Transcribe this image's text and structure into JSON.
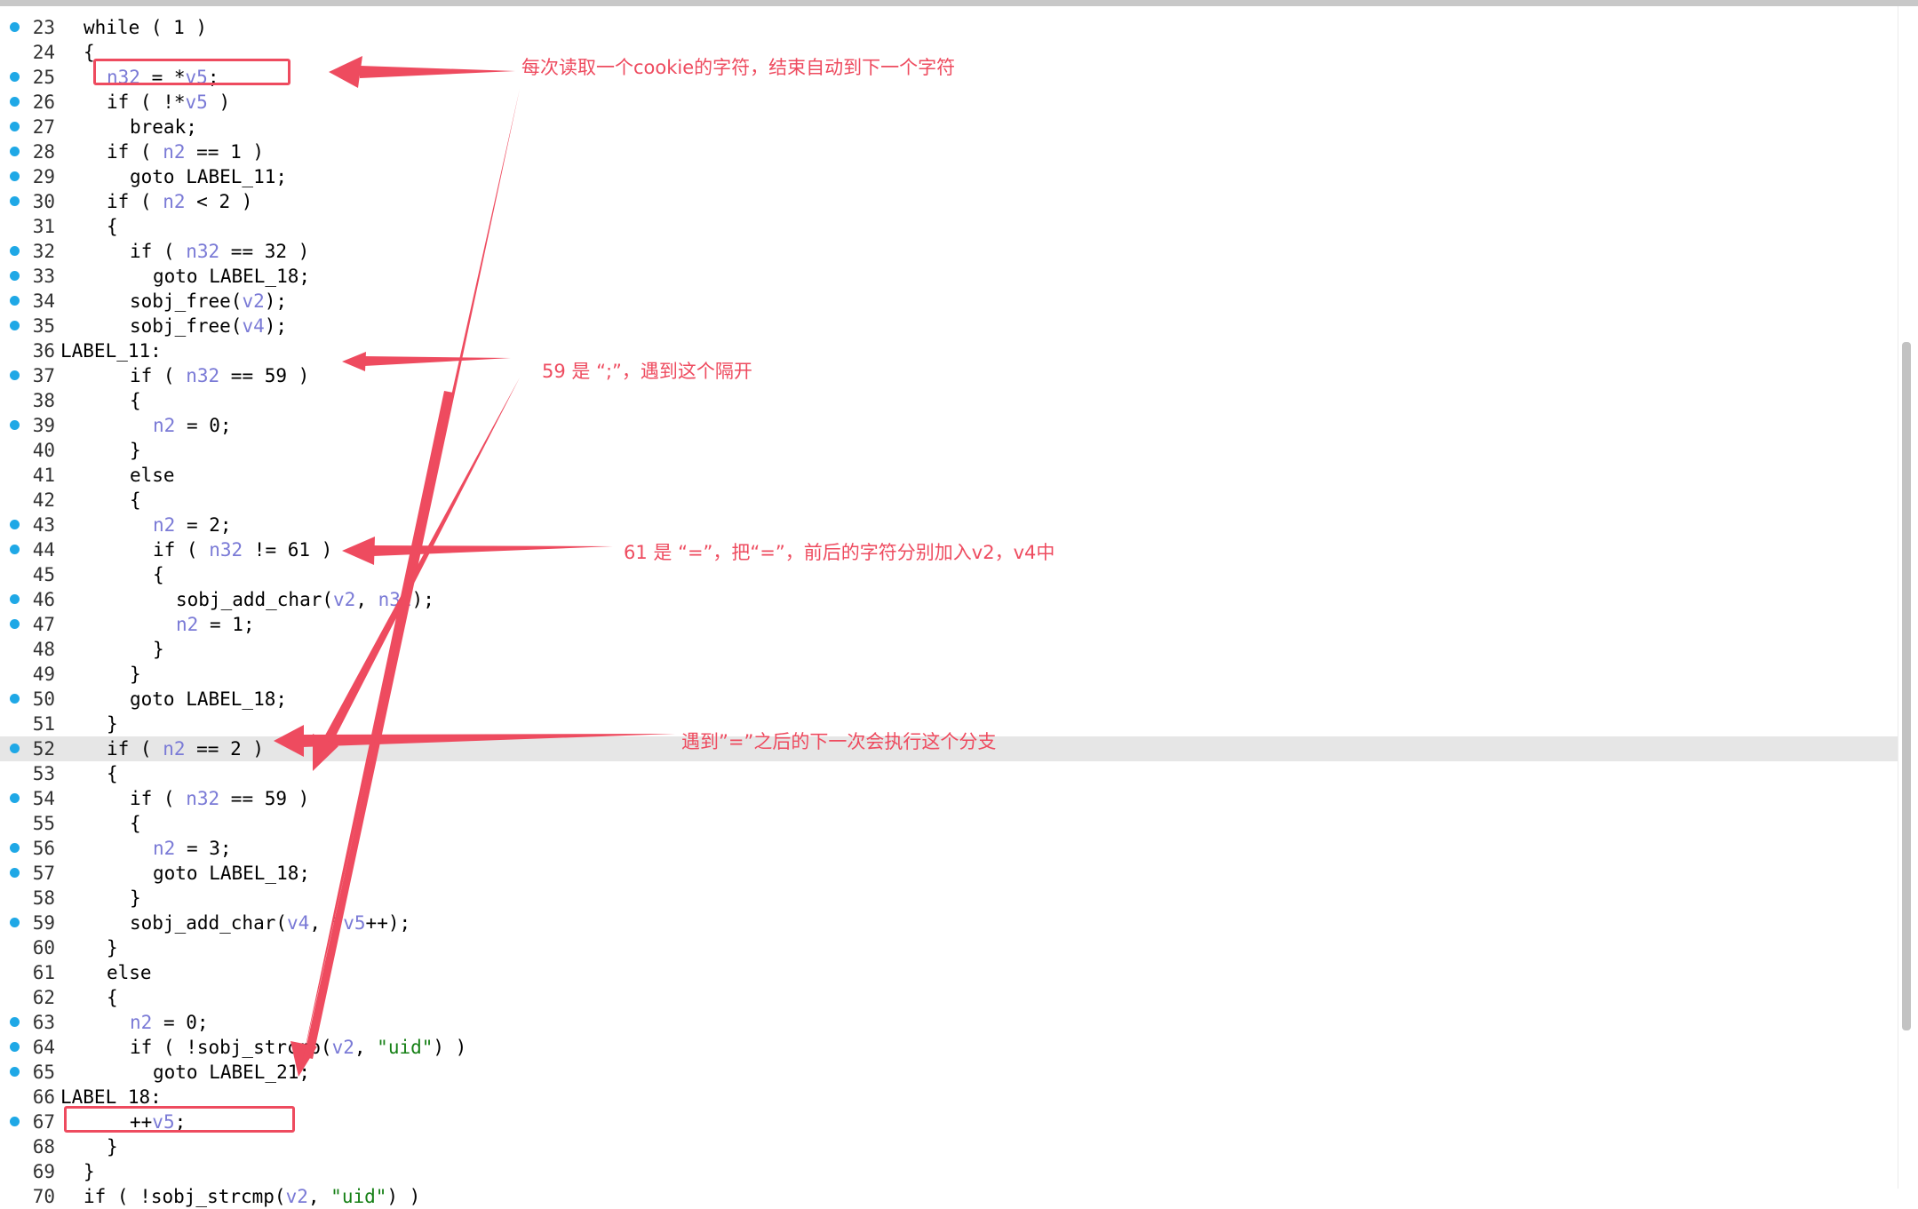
{
  "code_lines": [
    {
      "num": "23",
      "dot": true,
      "indent": 1,
      "tokens": [
        [
          "while ( 1 )",
          ""
        ]
      ]
    },
    {
      "num": "24",
      "dot": false,
      "indent": 1,
      "tokens": [
        [
          "{",
          ""
        ]
      ]
    },
    {
      "num": "25",
      "dot": true,
      "indent": 2,
      "tokens": [
        [
          "n32",
          "v"
        ],
        [
          " = *",
          ""
        ],
        [
          "v5",
          "v"
        ],
        [
          ";",
          ""
        ]
      ]
    },
    {
      "num": "26",
      "dot": true,
      "indent": 2,
      "tokens": [
        [
          "if ( !*",
          ""
        ],
        [
          "v5",
          "v"
        ],
        [
          " )",
          ""
        ]
      ]
    },
    {
      "num": "27",
      "dot": true,
      "indent": 3,
      "tokens": [
        [
          "break;",
          ""
        ]
      ]
    },
    {
      "num": "28",
      "dot": true,
      "indent": 2,
      "tokens": [
        [
          "if ( ",
          ""
        ],
        [
          "n2",
          "v"
        ],
        [
          " == 1 )",
          ""
        ]
      ]
    },
    {
      "num": "29",
      "dot": true,
      "indent": 3,
      "tokens": [
        [
          "goto LABEL_11;",
          ""
        ]
      ]
    },
    {
      "num": "30",
      "dot": true,
      "indent": 2,
      "tokens": [
        [
          "if ( ",
          ""
        ],
        [
          "n2",
          "v"
        ],
        [
          " < 2 )",
          ""
        ]
      ]
    },
    {
      "num": "31",
      "dot": false,
      "indent": 2,
      "tokens": [
        [
          "{",
          ""
        ]
      ]
    },
    {
      "num": "32",
      "dot": true,
      "indent": 3,
      "tokens": [
        [
          "if ( ",
          ""
        ],
        [
          "n32",
          "v"
        ],
        [
          " == 32 )",
          ""
        ]
      ]
    },
    {
      "num": "33",
      "dot": true,
      "indent": 4,
      "tokens": [
        [
          "goto LABEL_18;",
          ""
        ]
      ]
    },
    {
      "num": "34",
      "dot": true,
      "indent": 3,
      "tokens": [
        [
          "sobj_free(",
          ""
        ],
        [
          "v2",
          "v"
        ],
        [
          ");",
          ""
        ]
      ]
    },
    {
      "num": "35",
      "dot": true,
      "indent": 3,
      "tokens": [
        [
          "sobj_free(",
          ""
        ],
        [
          "v4",
          "v"
        ],
        [
          ");",
          ""
        ]
      ]
    },
    {
      "num": "36",
      "dot": false,
      "indent": 0,
      "tokens": [
        [
          "LABEL_11:",
          ""
        ]
      ]
    },
    {
      "num": "37",
      "dot": true,
      "indent": 3,
      "tokens": [
        [
          "if ( ",
          ""
        ],
        [
          "n32",
          "v"
        ],
        [
          " == 59 )",
          ""
        ]
      ]
    },
    {
      "num": "38",
      "dot": false,
      "indent": 3,
      "tokens": [
        [
          "{",
          ""
        ]
      ]
    },
    {
      "num": "39",
      "dot": true,
      "indent": 4,
      "tokens": [
        [
          "n2",
          "v"
        ],
        [
          " = 0;",
          ""
        ]
      ]
    },
    {
      "num": "40",
      "dot": false,
      "indent": 3,
      "tokens": [
        [
          "}",
          ""
        ]
      ]
    },
    {
      "num": "41",
      "dot": false,
      "indent": 3,
      "tokens": [
        [
          "else",
          ""
        ]
      ]
    },
    {
      "num": "42",
      "dot": false,
      "indent": 3,
      "tokens": [
        [
          "{",
          ""
        ]
      ]
    },
    {
      "num": "43",
      "dot": true,
      "indent": 4,
      "tokens": [
        [
          "n2",
          "v"
        ],
        [
          " = 2;",
          ""
        ]
      ]
    },
    {
      "num": "44",
      "dot": true,
      "indent": 4,
      "tokens": [
        [
          "if ( ",
          ""
        ],
        [
          "n32",
          "v"
        ],
        [
          " != 61 )",
          ""
        ]
      ]
    },
    {
      "num": "45",
      "dot": false,
      "indent": 4,
      "tokens": [
        [
          "{",
          ""
        ]
      ]
    },
    {
      "num": "46",
      "dot": true,
      "indent": 5,
      "tokens": [
        [
          "sobj_add_char(",
          ""
        ],
        [
          "v2",
          "v"
        ],
        [
          ", ",
          ""
        ],
        [
          "n32",
          "v"
        ],
        [
          ");",
          ""
        ]
      ]
    },
    {
      "num": "47",
      "dot": true,
      "indent": 5,
      "tokens": [
        [
          "n2",
          "v"
        ],
        [
          " = 1;",
          ""
        ]
      ]
    },
    {
      "num": "48",
      "dot": false,
      "indent": 4,
      "tokens": [
        [
          "}",
          ""
        ]
      ]
    },
    {
      "num": "49",
      "dot": false,
      "indent": 3,
      "tokens": [
        [
          "}",
          ""
        ]
      ]
    },
    {
      "num": "50",
      "dot": true,
      "indent": 3,
      "tokens": [
        [
          "goto LABEL_18;",
          ""
        ]
      ]
    },
    {
      "num": "51",
      "dot": false,
      "indent": 2,
      "tokens": [
        [
          "}",
          ""
        ]
      ]
    },
    {
      "num": "52",
      "dot": true,
      "indent": 2,
      "hl": true,
      "tokens": [
        [
          "if ( ",
          ""
        ],
        [
          "n2",
          "v"
        ],
        [
          " == 2 )",
          ""
        ]
      ]
    },
    {
      "num": "53",
      "dot": false,
      "indent": 2,
      "tokens": [
        [
          "{",
          ""
        ]
      ]
    },
    {
      "num": "54",
      "dot": true,
      "indent": 3,
      "tokens": [
        [
          "if ( ",
          ""
        ],
        [
          "n32",
          "v"
        ],
        [
          " == 59 )",
          ""
        ]
      ]
    },
    {
      "num": "55",
      "dot": false,
      "indent": 3,
      "tokens": [
        [
          "{",
          ""
        ]
      ]
    },
    {
      "num": "56",
      "dot": true,
      "indent": 4,
      "tokens": [
        [
          "n2",
          "v"
        ],
        [
          " = 3;",
          ""
        ]
      ]
    },
    {
      "num": "57",
      "dot": true,
      "indent": 4,
      "tokens": [
        [
          "goto LABEL_18;",
          ""
        ]
      ]
    },
    {
      "num": "58",
      "dot": false,
      "indent": 3,
      "tokens": [
        [
          "}",
          ""
        ]
      ]
    },
    {
      "num": "59",
      "dot": true,
      "indent": 3,
      "tokens": [
        [
          "sobj_add_char(",
          ""
        ],
        [
          "v4",
          "v"
        ],
        [
          ", *",
          ""
        ],
        [
          "v5",
          "v"
        ],
        [
          "++);",
          ""
        ]
      ]
    },
    {
      "num": "60",
      "dot": false,
      "indent": 2,
      "tokens": [
        [
          "}",
          ""
        ]
      ]
    },
    {
      "num": "61",
      "dot": false,
      "indent": 2,
      "tokens": [
        [
          "else",
          ""
        ]
      ]
    },
    {
      "num": "62",
      "dot": false,
      "indent": 2,
      "tokens": [
        [
          "{",
          ""
        ]
      ]
    },
    {
      "num": "63",
      "dot": true,
      "indent": 3,
      "tokens": [
        [
          "n2",
          "v"
        ],
        [
          " = 0;",
          ""
        ]
      ]
    },
    {
      "num": "64",
      "dot": true,
      "indent": 3,
      "tokens": [
        [
          "if ( !sobj_strcmp(",
          ""
        ],
        [
          "v2",
          "v"
        ],
        [
          ", ",
          ""
        ],
        [
          "\"uid\"",
          "s"
        ],
        [
          ") )",
          ""
        ]
      ]
    },
    {
      "num": "65",
      "dot": true,
      "indent": 4,
      "tokens": [
        [
          "goto LABEL_21;",
          ""
        ]
      ]
    },
    {
      "num": "66",
      "dot": false,
      "indent": 0,
      "tokens": [
        [
          "LABEL_18:",
          ""
        ]
      ]
    },
    {
      "num": "67",
      "dot": true,
      "indent": 3,
      "tokens": [
        [
          "++",
          ""
        ],
        [
          "v5",
          "v"
        ],
        [
          ";",
          ""
        ]
      ]
    },
    {
      "num": "68",
      "dot": false,
      "indent": 2,
      "tokens": [
        [
          "}",
          ""
        ]
      ]
    },
    {
      "num": "69",
      "dot": false,
      "indent": 1,
      "tokens": [
        [
          "}",
          ""
        ]
      ]
    },
    {
      "num": "70",
      "dot": false,
      "indent": 1,
      "tokens": [
        [
          "if ( !sobj_strcmp(",
          ""
        ],
        [
          "v2",
          "v"
        ],
        [
          ", ",
          ""
        ],
        [
          "\"uid\"",
          "s"
        ],
        [
          ") )",
          ""
        ]
      ]
    }
  ],
  "annotations": {
    "note1": "每次读取一个cookie的字符，结束自动到下一个字符",
    "note2": "59 是 “;”，遇到这个隔开",
    "note3": "61 是 “=”，把“=”，前后的字符分别加入v2，v4中",
    "note4": "遇到”=”之后的下一次会执行这个分支"
  },
  "colors": {
    "accent": "#ee4b5f",
    "breakpoint_dot": "#1fa8e6",
    "variable": "#7a7ad6",
    "string": "#168016",
    "highlight_line": "#e6e6e6"
  }
}
